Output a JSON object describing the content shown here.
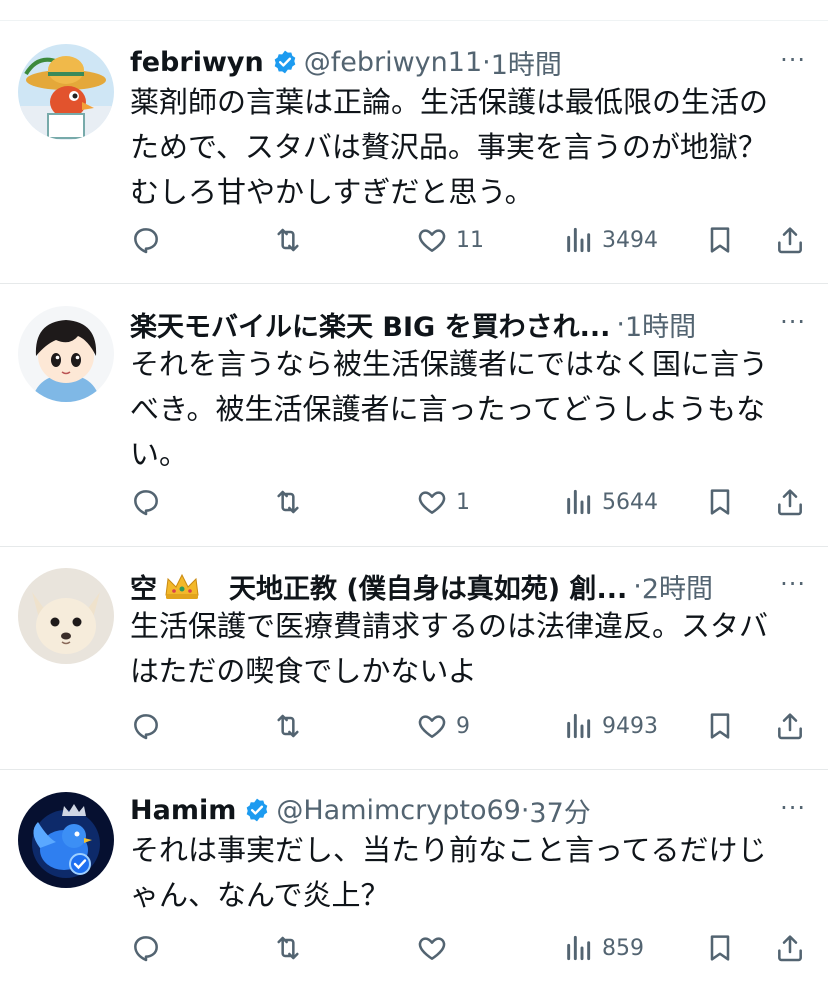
{
  "tweets": [
    {
      "name": "febriwyn",
      "verified": true,
      "handle": "@febriwyn11",
      "sep": "·",
      "time": "1時間",
      "text_lines": [
        "薬剤師の言葉は正論。生活保護は最低限の生活の",
        "ためで、スタバは贅沢品。事実を言うのが地獄？",
        "むしろ甘やかしすぎだと思う。"
      ],
      "likes": "11",
      "views": "3494",
      "avatar_icon": "sombrero-bird-avatar"
    },
    {
      "name": "楽天モバイルに楽天 BIG を買わされ...",
      "verified": false,
      "handle": "",
      "sep": "·",
      "time": "1時間",
      "text_lines": [
        "それを言うなら被生活保護者にではなく国に言う",
        "べき。被生活保護者に言ったってどうしようもな",
        "い。"
      ],
      "likes": "1",
      "views": "5644",
      "avatar_icon": "anime-girl-avatar"
    },
    {
      "name_prefix": "空",
      "name": "天地正教 (僕自身は真如苑) 創...",
      "verified": false,
      "handle": "",
      "sep": "·",
      "time": "2時間",
      "text_lines": [
        "生活保護で医療費請求するのは法律違反。スタバ",
        "はただの喫食でしかないよ"
      ],
      "likes": "9",
      "views": "9493",
      "avatar_icon": "chihuahua-avatar"
    },
    {
      "name": "Hamim",
      "verified": true,
      "handle": "@Hamimcrypto69",
      "sep": "·",
      "time": "37分",
      "text_lines": [
        "それは事実だし、当たり前なこと言ってるだけじ",
        "ゃん、なんで炎上？"
      ],
      "likes": "",
      "views": "859",
      "avatar_icon": "crowned-blue-bird-avatar"
    }
  ],
  "more_label": "···",
  "colors": {
    "text": "#0f1419",
    "secondary": "#536471",
    "verified": "#1d9bf0"
  }
}
